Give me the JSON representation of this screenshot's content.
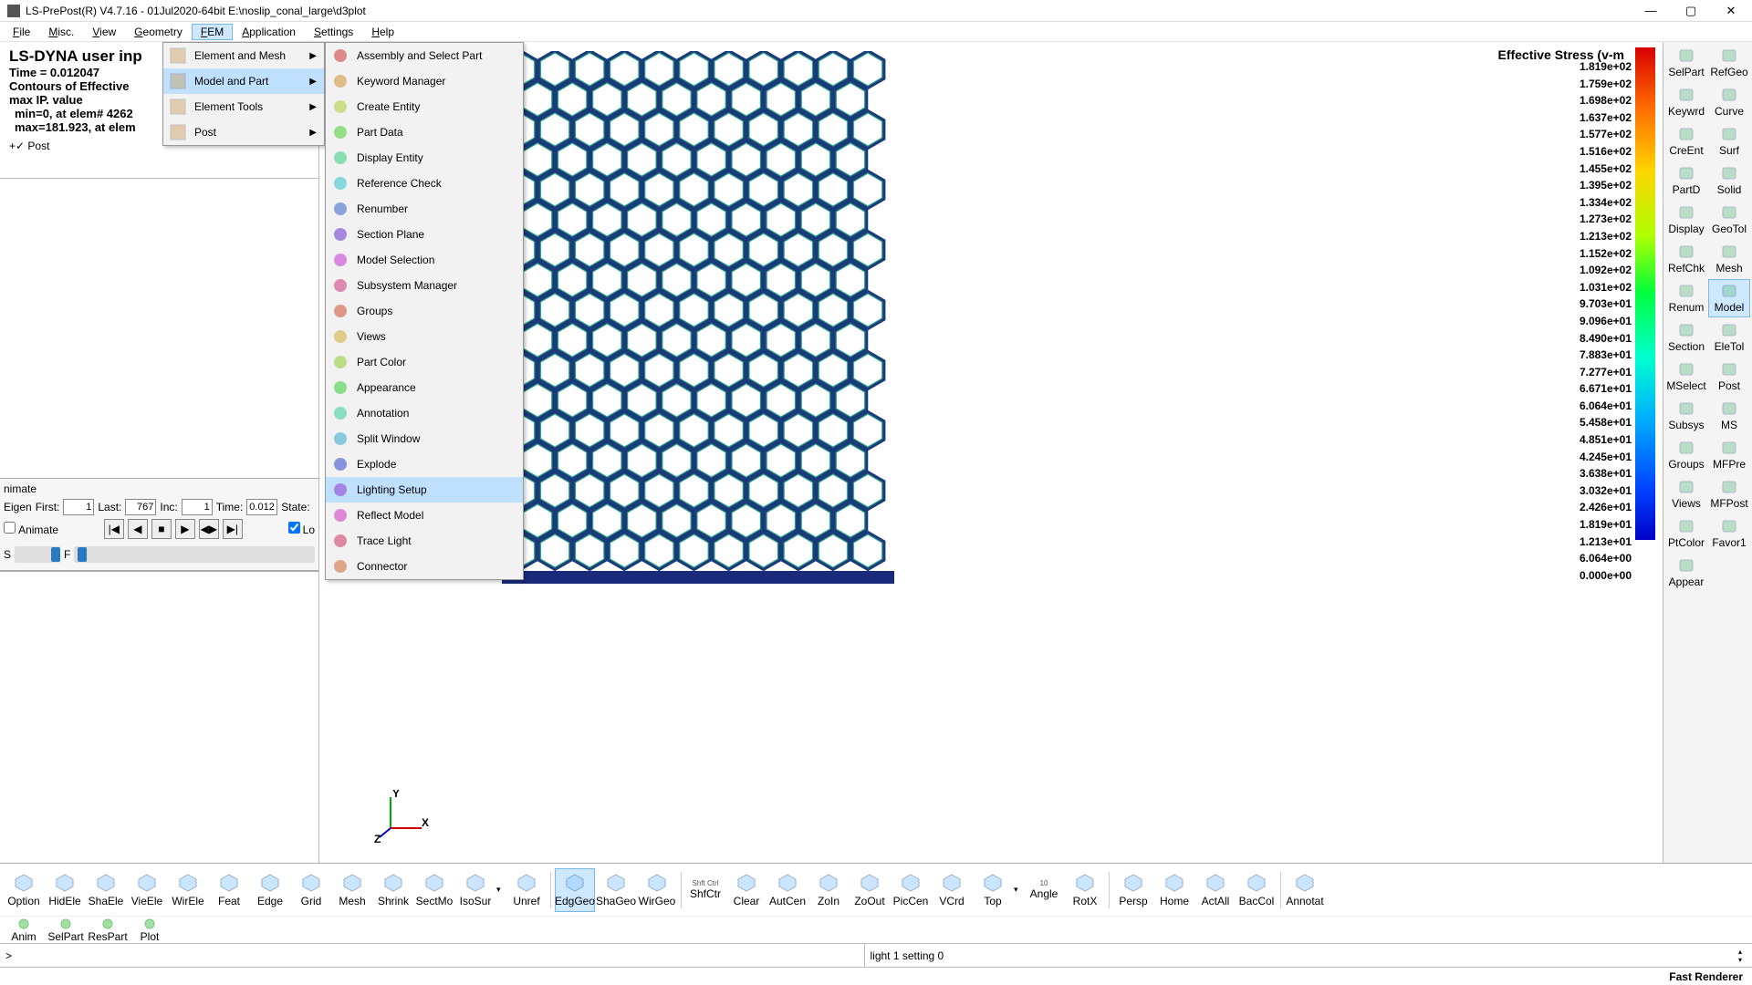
{
  "window": {
    "title": "LS-PrePost(R) V4.7.16 - 01Jul2020-64bit E:\\noslip_conal_large\\d3plot"
  },
  "menubar": [
    "File",
    "Misc.",
    "View",
    "Geometry",
    "FEM",
    "Application",
    "Settings",
    "Help"
  ],
  "menubar_open_index": 4,
  "dropdown1": [
    {
      "label": "Element and Mesh",
      "arrow": true
    },
    {
      "label": "Model and Part",
      "arrow": true,
      "hi": true
    },
    {
      "label": "Element Tools",
      "arrow": true
    },
    {
      "label": "Post",
      "arrow": true
    }
  ],
  "dropdown2": [
    "Assembly and Select Part",
    "Keyword Manager",
    "Create Entity",
    "Part Data",
    "Display Entity",
    "Reference Check",
    "Renumber",
    "Section Plane",
    "Model Selection",
    "Subsystem Manager",
    "Groups",
    "Views",
    "Part Color",
    "Appearance",
    "Annotation",
    "Split Window",
    "Explode",
    "Lighting Setup",
    "Reflect Model",
    "Trace Light",
    "Connector"
  ],
  "dropdown2_hi_index": 17,
  "info": {
    "l1": "LS-DYNA user inp",
    "l2": "Time =     0.012047",
    "l3": "Contours of Effective",
    "l4": "max IP. value",
    "l5": "min=0, at elem# 4262",
    "l6": "max=181.923, at elem"
  },
  "tree_root": "Post",
  "anim": {
    "tab": "nimate",
    "eigen": "Eigen",
    "first_l": "First:",
    "first": "1",
    "last_l": "Last:",
    "last": "767",
    "inc_l": "Inc:",
    "inc": "1",
    "time_l": "Time:",
    "time": "0.012047",
    "state_l": "State:",
    "animate": "Animate",
    "loop": "Lo",
    "s_label": "S",
    "f_label": "F"
  },
  "legend": {
    "title": "Effective Stress (v-m",
    "values": [
      "1.819e+02",
      "1.759e+02",
      "1.698e+02",
      "1.637e+02",
      "1.577e+02",
      "1.516e+02",
      "1.455e+02",
      "1.395e+02",
      "1.334e+02",
      "1.273e+02",
      "1.213e+02",
      "1.152e+02",
      "1.092e+02",
      "1.031e+02",
      "9.703e+01",
      "9.096e+01",
      "8.490e+01",
      "7.883e+01",
      "7.277e+01",
      "6.671e+01",
      "6.064e+01",
      "5.458e+01",
      "4.851e+01",
      "4.245e+01",
      "3.638e+01",
      "3.032e+01",
      "2.426e+01",
      "1.819e+01",
      "1.213e+01",
      "6.064e+00",
      "0.000e+00"
    ]
  },
  "right_tools": [
    {
      "l": "SelPart"
    },
    {
      "l": "RefGeo"
    },
    {
      "l": "Keywrd"
    },
    {
      "l": "Curve"
    },
    {
      "l": "CreEnt"
    },
    {
      "l": "Surf"
    },
    {
      "l": "PartD"
    },
    {
      "l": "Solid"
    },
    {
      "l": "Display"
    },
    {
      "l": "GeoTol"
    },
    {
      "l": "RefChk"
    },
    {
      "l": "Mesh"
    },
    {
      "l": "Renum"
    },
    {
      "l": "Model",
      "sel": true
    },
    {
      "l": "Section"
    },
    {
      "l": "EleTol"
    },
    {
      "l": "MSelect"
    },
    {
      "l": "Post"
    },
    {
      "l": "Subsys"
    },
    {
      "l": "MS"
    },
    {
      "l": "Groups"
    },
    {
      "l": "MFPre"
    },
    {
      "l": "Views"
    },
    {
      "l": "MFPost"
    },
    {
      "l": "PtColor"
    },
    {
      "l": "Favor1"
    },
    {
      "l": "Appear"
    }
  ],
  "bottom": [
    {
      "l": "Option"
    },
    {
      "l": "HidEle"
    },
    {
      "l": "ShaEle"
    },
    {
      "l": "VieEle"
    },
    {
      "l": "WirEle"
    },
    {
      "l": "Feat"
    },
    {
      "l": "Edge"
    },
    {
      "l": "Grid"
    },
    {
      "l": "Mesh"
    },
    {
      "l": "Shrink"
    },
    {
      "l": "SectMo"
    },
    {
      "l": "IsoSur"
    },
    {
      "drop": true
    },
    {
      "l": "Unref"
    },
    {
      "sep": true
    },
    {
      "l": "EdgGeo",
      "sel": true
    },
    {
      "l": "ShaGeo"
    },
    {
      "l": "WirGeo"
    },
    {
      "sep": true
    },
    {
      "l": "ShfCtr",
      "sub": "Shft Ctrl"
    },
    {
      "l": "Clear"
    },
    {
      "l": "AutCen"
    },
    {
      "l": "ZoIn"
    },
    {
      "l": "ZoOut"
    },
    {
      "l": "PicCen"
    },
    {
      "l": "VCrd"
    },
    {
      "l": "Top"
    },
    {
      "drop": true
    },
    {
      "l": "Angle",
      "sub": "10"
    },
    {
      "l": "RotX"
    },
    {
      "sep": true
    },
    {
      "l": "Persp"
    },
    {
      "l": "Home"
    },
    {
      "l": "ActAll"
    },
    {
      "l": "BacCol"
    },
    {
      "sep": true
    },
    {
      "l": "Annotat"
    }
  ],
  "row2": [
    {
      "l": "Anim"
    },
    {
      "l": "SelPart"
    },
    {
      "l": "ResPart"
    },
    {
      "l": "Plot"
    }
  ],
  "cmd_prompt": ">",
  "status_msg": "light 1 setting 0",
  "renderer": "Fast Renderer"
}
